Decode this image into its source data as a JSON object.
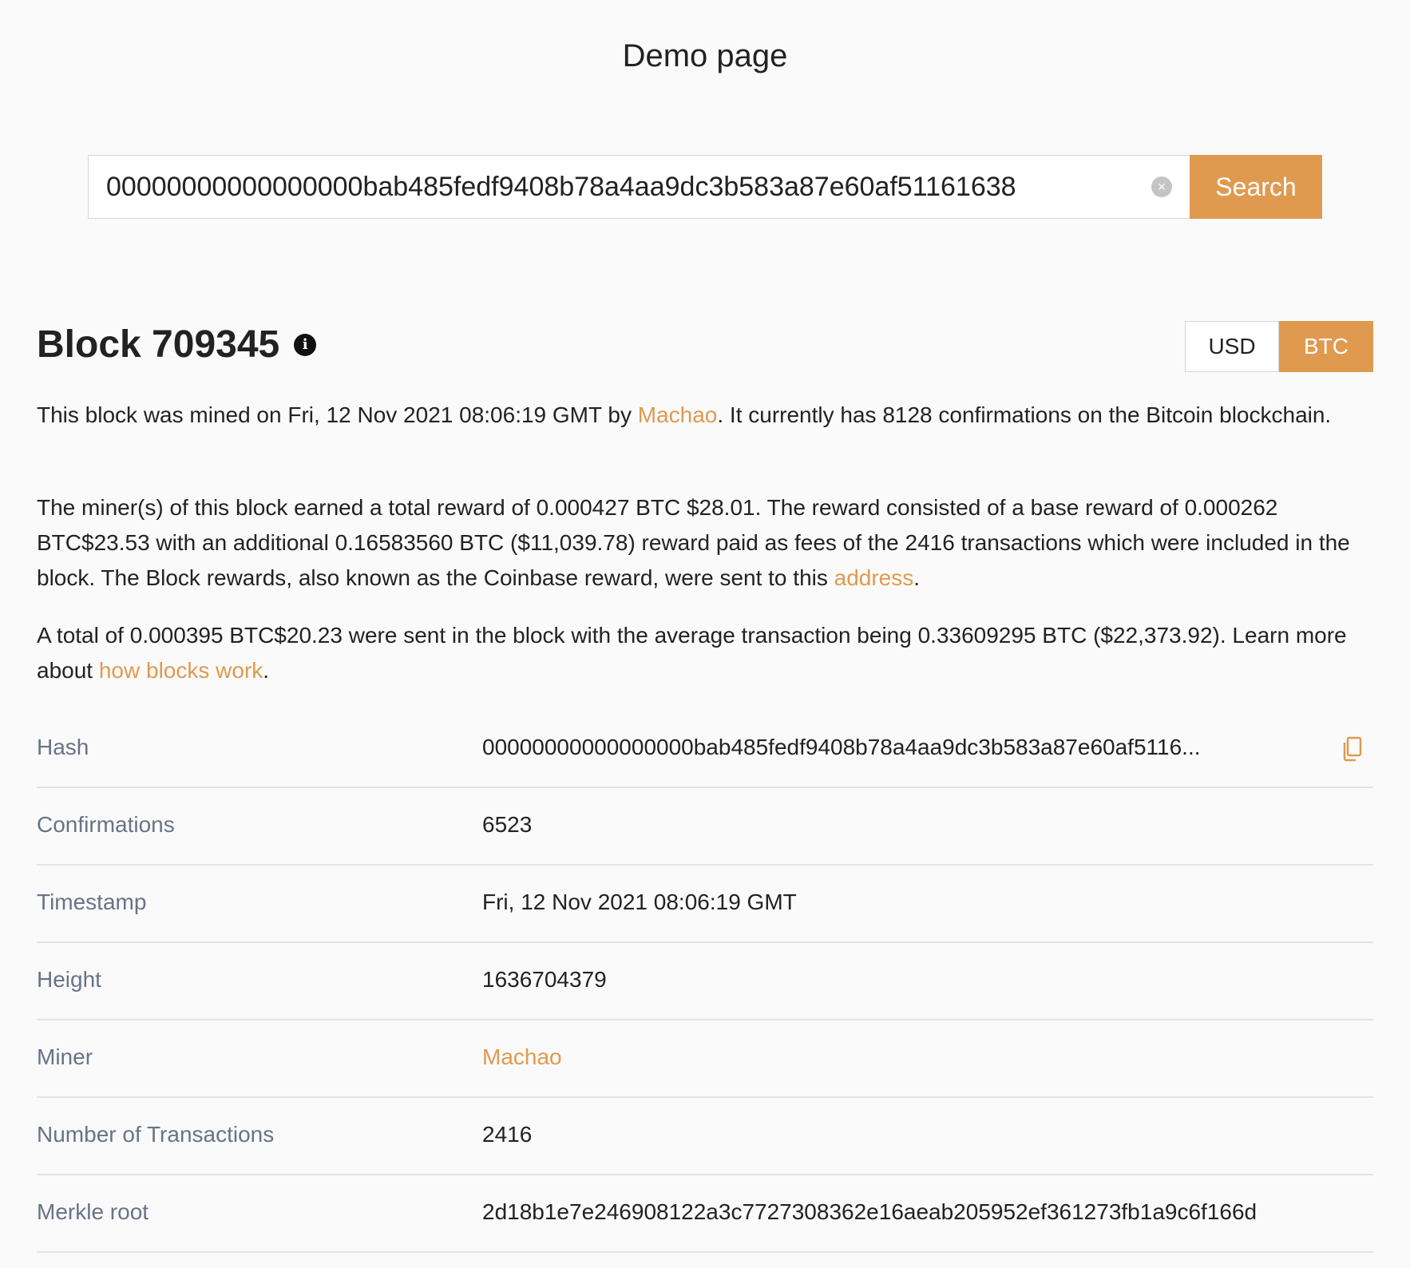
{
  "page": {
    "title": "Demo page"
  },
  "search": {
    "value": "00000000000000000bab485fedf9408b78a4aa9dc3b583a87e60af51161638",
    "button_label": "Search",
    "clear_icon": "×"
  },
  "block": {
    "title": "Block 709345",
    "info_icon": "i"
  },
  "currency_toggle": {
    "usd_label": "USD",
    "btc_label": "BTC",
    "selected": "BTC"
  },
  "description": {
    "p1_before": "This block was mined on Fri, 12 Nov 2021 08:06:19 GMT by ",
    "p1_link": "Machao",
    "p1_after": ". It currently has 8128 confirmations on the Bitcoin blockchain.",
    "p2_before": "The miner(s) of this block earned a total reward of 0.000427 BTC $28.01. The reward consisted of a base reward of 0.000262 BTC$23.53 with an additional 0.16583560 BTC ($11,039.78) reward paid as fees of the 2416 transactions which were included in the block. The Block rewards, also known as the Coinbase reward, were sent to this ",
    "p2_link": "address",
    "p2_after": ".",
    "p3_before": "A total of 0.000395 BTC$20.23 were sent in the block with the average transaction being 0.33609295 BTC ($22,373.92). Learn more about ",
    "p3_link": "how blocks work",
    "p3_after": "."
  },
  "details": [
    {
      "label": "Hash",
      "value": "00000000000000000bab485fedf9408b78a4aa9dc3b583a87e60af5116..."
    },
    {
      "label": "Confirmations",
      "value": "6523"
    },
    {
      "label": "Timestamp",
      "value": "Fri, 12 Nov 2021 08:06:19 GMT"
    },
    {
      "label": "Height",
      "value": "1636704379"
    },
    {
      "label": "Miner",
      "value": "Machao"
    },
    {
      "label": "Number of Transactions",
      "value": "2416"
    },
    {
      "label": "Merkle root",
      "value": "2d18b1e7e246908122a3c7727308362e16aeab205952ef361273fb1a9c6f166d"
    }
  ],
  "colors": {
    "accent": "#e09a4f",
    "label": "#687387",
    "text": "#222222",
    "background": "#fafafa"
  },
  "icons": {
    "clear": "clear-icon",
    "info": "info-icon",
    "copy": "copy-icon"
  }
}
